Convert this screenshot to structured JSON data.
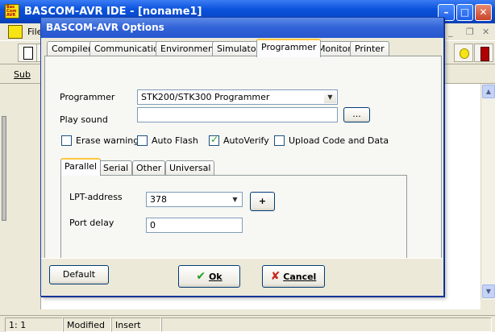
{
  "main_window": {
    "title": "BASCOM-AVR IDE - [noname1]",
    "icon_text": "Bas Com AVR",
    "menu_file": "File",
    "sub_label": "Sub"
  },
  "dialog": {
    "title": "BASCOM-AVR Options",
    "tabs": [
      "Compiler",
      "Communication",
      "Environment",
      "Simulator",
      "Programmer",
      "Monitor",
      "Printer"
    ],
    "active_tab": "Programmer",
    "programmer_label": "Programmer",
    "programmer_value": "STK200/STK300 Programmer",
    "play_sound_label": "Play sound",
    "play_sound_value": "",
    "browse_label": "...",
    "checkboxes": [
      {
        "label": "Erase warning",
        "checked": false
      },
      {
        "label": "Auto Flash",
        "checked": false
      },
      {
        "label": "AutoVerify",
        "checked": true
      },
      {
        "label": "Upload Code and Data",
        "checked": false
      }
    ],
    "subtabs": [
      "Parallel",
      "Serial",
      "Other",
      "Universal"
    ],
    "active_subtab": "Parallel",
    "lpt_label": "LPT-address",
    "lpt_value": "378",
    "plus_label": "+",
    "port_delay_label": "Port delay",
    "port_delay_value": "0",
    "default_button": "Default",
    "ok_button": "Ok",
    "cancel_button": "Cancel"
  },
  "status_bar": {
    "position": "1: 1",
    "modified": "Modified",
    "mode": "Insert"
  },
  "colors": {
    "titlebar": "#0a52dc",
    "dialog_titlebar": "#3162d8",
    "face": "#ece9d8",
    "ok_check": "#21a121",
    "cancel_x": "#c8281e"
  }
}
